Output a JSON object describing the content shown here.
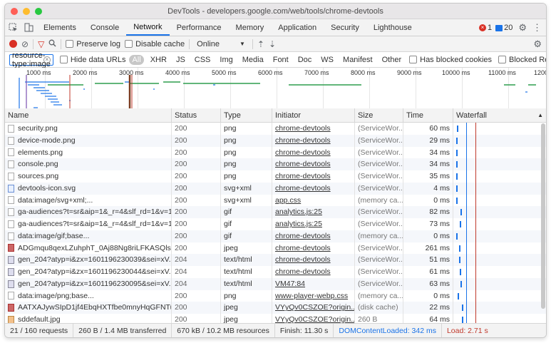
{
  "window": {
    "title": "DevTools - developers.google.com/web/tools/chrome-devtools",
    "lights": [
      "#ff5f57",
      "#febc2e",
      "#28c840"
    ]
  },
  "tabs": [
    {
      "label": "Elements",
      "active": false
    },
    {
      "label": "Console",
      "active": false
    },
    {
      "label": "Network",
      "active": true
    },
    {
      "label": "Performance",
      "active": false
    },
    {
      "label": "Memory",
      "active": false
    },
    {
      "label": "Application",
      "active": false
    },
    {
      "label": "Security",
      "active": false
    },
    {
      "label": "Lighthouse",
      "active": false
    }
  ],
  "indicators": {
    "errors": "1",
    "messages": "20"
  },
  "toolbar": {
    "preserve_log": "Preserve log",
    "disable_cache": "Disable cache",
    "throttle": "Online"
  },
  "filter": {
    "value": "resource-type:image",
    "hide_data_urls": "Hide data URLs",
    "types": [
      "All",
      "XHR",
      "JS",
      "CSS",
      "Img",
      "Media",
      "Font",
      "Doc",
      "WS",
      "Manifest",
      "Other"
    ],
    "active_type": "All",
    "has_blocked_cookies": "Has blocked cookies",
    "blocked_requests": "Blocked Requests"
  },
  "overview": {
    "ticks": [
      "1000 ms",
      "2000 ms",
      "3000 ms",
      "4000 ms",
      "5000 ms",
      "6000 ms",
      "7000 ms",
      "8000 ms",
      "9000 ms",
      "10000 ms",
      "11000 ms",
      "1200"
    ]
  },
  "columns": {
    "name": "Name",
    "status": "Status",
    "type": "Type",
    "initiator": "Initiator",
    "size": "Size",
    "time": "Time",
    "waterfall": "Waterfall"
  },
  "rows": [
    {
      "name": "security.png",
      "status": "200",
      "type": "png",
      "initiator": "chrome-devtools",
      "size": "(ServiceWor...",
      "time": "60 ms",
      "icon": "image-file-icon"
    },
    {
      "name": "device-mode.png",
      "status": "200",
      "type": "png",
      "initiator": "chrome-devtools",
      "size": "(ServiceWor...",
      "time": "29 ms",
      "icon": "image-file-icon"
    },
    {
      "name": "elements.png",
      "status": "200",
      "type": "png",
      "initiator": "chrome-devtools",
      "size": "(ServiceWor...",
      "time": "34 ms",
      "icon": "image-file-icon"
    },
    {
      "name": "console.png",
      "status": "200",
      "type": "png",
      "initiator": "chrome-devtools",
      "size": "(ServiceWor...",
      "time": "34 ms",
      "icon": "image-file-icon"
    },
    {
      "name": "sources.png",
      "status": "200",
      "type": "png",
      "initiator": "chrome-devtools",
      "size": "(ServiceWor...",
      "time": "35 ms",
      "icon": "image-file-icon"
    },
    {
      "name": "devtools-icon.svg",
      "status": "200",
      "type": "svg+xml",
      "initiator": "chrome-devtools",
      "size": "(ServiceWor...",
      "time": "4 ms",
      "icon": "svg-file-icon"
    },
    {
      "name": "data:image/svg+xml;...",
      "status": "200",
      "type": "svg+xml",
      "initiator": "app.css",
      "size": "(memory ca...",
      "time": "0 ms",
      "icon": "image-file-icon"
    },
    {
      "name": "ga-audiences?t=sr&aip=1&_r=4&slf_rd=1&v=1...",
      "status": "200",
      "type": "gif",
      "initiator": "analytics.js:25",
      "size": "(ServiceWor...",
      "time": "82 ms",
      "icon": "image-file-icon"
    },
    {
      "name": "ga-audiences?t=sr&aip=1&_r=4&slf_rd=1&v=1...",
      "status": "200",
      "type": "gif",
      "initiator": "analytics.js:25",
      "size": "(ServiceWor...",
      "time": "73 ms",
      "icon": "image-file-icon"
    },
    {
      "name": "data:image/gif;base...",
      "status": "200",
      "type": "gif",
      "initiator": "chrome-devtools",
      "size": "(memory ca...",
      "time": "0 ms",
      "icon": "image-file-icon"
    },
    {
      "name": "ADGmqu8qexLZuhphT_0Aj88Ng8riLFKASQlsIt...",
      "status": "200",
      "type": "jpeg",
      "initiator": "chrome-devtools",
      "size": "(ServiceWor...",
      "time": "261 ms",
      "icon": "photo-thumbnail-icon"
    },
    {
      "name": "gen_204?atyp=i&zx=1601196230039&sei=xV...",
      "status": "204",
      "type": "text/html",
      "initiator": "chrome-devtools",
      "size": "(ServiceWor...",
      "time": "51 ms",
      "icon": "image-thumbnail-icon"
    },
    {
      "name": "gen_204?atyp=i&zx=1601196230044&sei=xV...",
      "status": "204",
      "type": "text/html",
      "initiator": "chrome-devtools",
      "size": "(ServiceWor...",
      "time": "61 ms",
      "icon": "image-thumbnail-icon"
    },
    {
      "name": "gen_204?atyp=i&zx=1601196230095&sei=xV...",
      "status": "204",
      "type": "text/html",
      "initiator": "VM47:84",
      "size": "(ServiceWor...",
      "time": "63 ms",
      "icon": "image-thumbnail-icon"
    },
    {
      "name": "data:image/png;base...",
      "status": "200",
      "type": "png",
      "initiator": "www-player-webp.css",
      "size": "(memory ca...",
      "time": "0 ms",
      "icon": "image-file-icon"
    },
    {
      "name": "AATXAJywSIpD1jf4EbqHXTfbe0mnyHqGFNTu...",
      "status": "200",
      "type": "jpeg",
      "initiator": "VYyQv0CSZOE?origin...",
      "size": "(disk cache)",
      "time": "22 ms",
      "icon": "photo-thumbnail-icon"
    },
    {
      "name": "sddefault.jpg",
      "status": "200",
      "type": "jpeg",
      "initiator": "VYyQv0CSZOE?origin...",
      "size": "260 B",
      "time": "64 ms",
      "icon": "jpg-thumbnail-icon"
    }
  ],
  "statusbar": {
    "requests": "21 / 160 requests",
    "transferred": "260 B / 1.4 MB transferred",
    "resources": "670 kB / 10.2 MB resources",
    "finish": "Finish: 11.30 s",
    "dom_content_loaded": "DOMContentLoaded: 342 ms",
    "load": "Load: 2.71 s"
  },
  "colors": {
    "accent": "#1a73e8",
    "dom_line": "#1a73e8",
    "load_line": "#c0392b",
    "error": "#d93025"
  }
}
